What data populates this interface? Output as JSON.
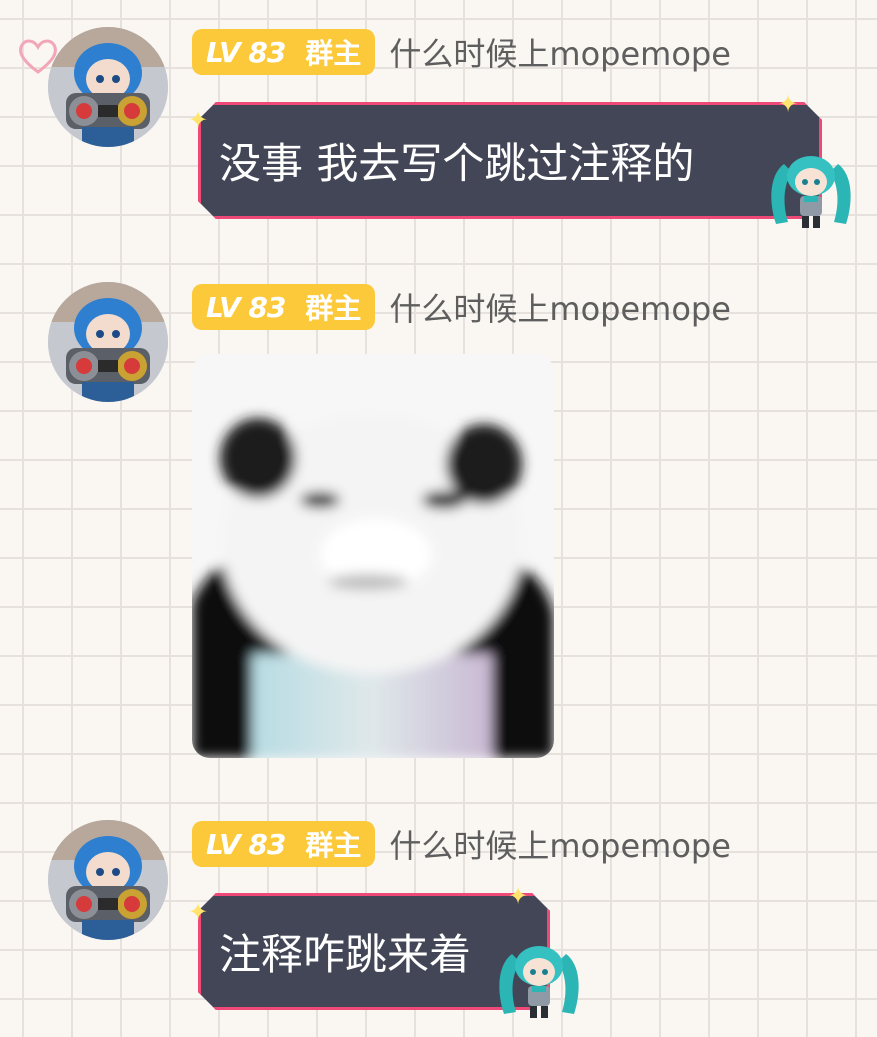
{
  "messages": [
    {
      "type": "text",
      "badge": {
        "level": "LV 83",
        "role": "群主"
      },
      "nickname": "什么时候上mopemope",
      "text": "没事 我去写个跳过注释的"
    },
    {
      "type": "sticker",
      "badge": {
        "level": "LV 83",
        "role": "群主"
      },
      "nickname": "什么时候上mopemope",
      "sticker": "panda-meme-sticker"
    },
    {
      "type": "text",
      "badge": {
        "level": "LV 83",
        "role": "群主"
      },
      "nickname": "什么时候上mopemope",
      "text": "注释咋跳来着"
    }
  ],
  "colors": {
    "background": "#faf7f2",
    "grid": "#e6e1dc",
    "badge": "#fcc93a",
    "bubble": "#434656",
    "bubble_border_inner": "#ef4a77",
    "bubble_border_outer": "#5e8ff0",
    "nickname": "#5e5e5e"
  }
}
